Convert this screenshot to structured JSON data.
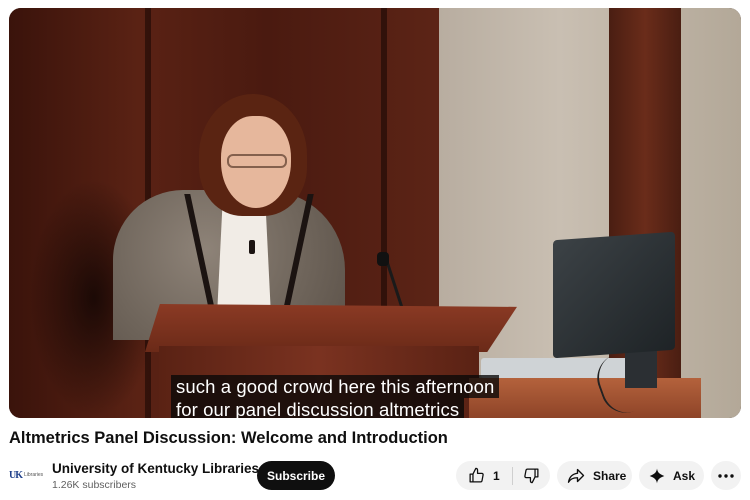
{
  "player": {
    "captions": [
      "such a good crowd here this afternoon",
      "for our panel discussion altmetrics"
    ]
  },
  "video": {
    "title": "Altmetrics Panel Discussion: Welcome and Introduction"
  },
  "channel": {
    "logo_text": "UK",
    "logo_subtext": "Libraries",
    "name": "University of Kentucky Libraries",
    "subscribers": "1.26K subscribers",
    "subscribe_label": "Subscribe"
  },
  "actions": {
    "like_count": "1",
    "share_label": "Share",
    "ask_label": "Ask",
    "icons": [
      "thumbs-up-icon",
      "thumbs-down-icon",
      "share-arrow-icon",
      "sparkle-icon",
      "more-horizontal-icon"
    ]
  },
  "colors": {
    "subscribe_bg": "#0f0f0f",
    "pill_bg": "#f2f2f2",
    "brand_blue": "#1e3f8a"
  }
}
